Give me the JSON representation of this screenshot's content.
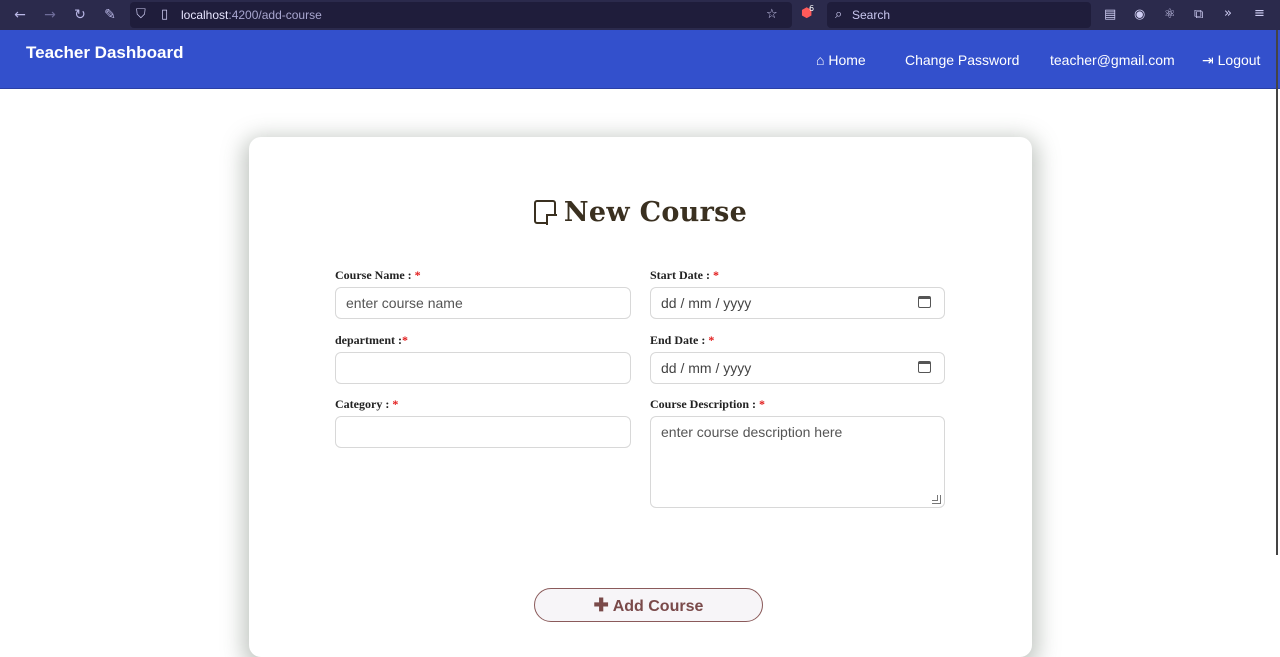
{
  "browser": {
    "url_host": "localhost",
    "url_path": ":4200/add-course",
    "search_placeholder": "Search",
    "badge_count": "6"
  },
  "navbar": {
    "brand": "Teacher Dashboard",
    "links": [
      {
        "icon": "home-icon",
        "label": "Home"
      },
      {
        "label": "Change Password"
      },
      {
        "label": "teacher@gmail.com"
      },
      {
        "icon": "logout-icon",
        "label": "Logout"
      }
    ]
  },
  "form": {
    "title": "New Course",
    "fields": {
      "course_name": {
        "label": "Course Name : ",
        "required": "*",
        "placeholder": "enter course name"
      },
      "start_date": {
        "label": "Start Date : ",
        "required": "*",
        "value": "dd / mm / yyyy"
      },
      "department": {
        "label": "department :",
        "required": "*",
        "value": ""
      },
      "end_date": {
        "label": "End Date : ",
        "required": "*",
        "value": "dd / mm / yyyy"
      },
      "category": {
        "label": "Category : ",
        "required": "*",
        "value": ""
      },
      "description": {
        "label": "Course Description : ",
        "required": "*",
        "placeholder": "enter course description here"
      }
    },
    "submit_label": "Add Course"
  },
  "colors": {
    "browser_bg": "#2b2a4c",
    "navbar_bg": "#3350cc",
    "required": "#e21d1d",
    "button_text": "#7a4a4a"
  }
}
